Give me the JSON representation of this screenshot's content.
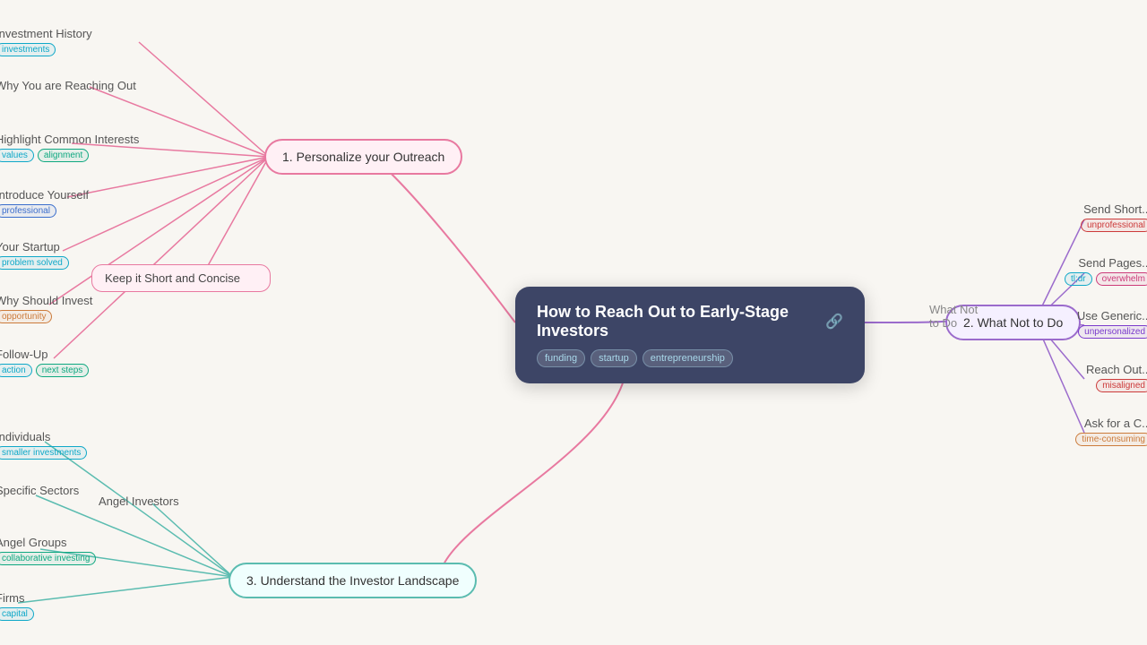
{
  "app": {
    "title": "How to Reach Out to Early-Stage Investors"
  },
  "central": {
    "title": "How to Reach Out to Early-Stage Investors",
    "link_icon": "🔗",
    "tags": [
      "funding",
      "startup",
      "entrepreneurship"
    ]
  },
  "branches": {
    "personalize": {
      "label": "1. Personalize your Outreach",
      "leaves": [
        {
          "label": "Investment History",
          "tags": [
            {
              "text": "investments",
              "type": "cyan"
            }
          ]
        },
        {
          "label": "Why You are Reaching Out",
          "tags": []
        },
        {
          "label": "Highlight Common Interests",
          "tags": [
            {
              "text": "values",
              "type": "cyan"
            },
            {
              "text": "alignment",
              "type": "teal"
            }
          ]
        },
        {
          "label": "Introduce Yourself",
          "tags": [
            {
              "text": "professional",
              "type": "blue"
            }
          ]
        },
        {
          "label": "Your Startup",
          "tags": [
            {
              "text": "problem solved",
              "type": "cyan"
            }
          ]
        },
        {
          "label": "Why Should Invest",
          "tags": [
            {
              "text": "opportunity",
              "type": "orange"
            }
          ]
        },
        {
          "label": "Follow-Up",
          "tags": [
            {
              "text": "action",
              "type": "cyan"
            },
            {
              "text": "next steps",
              "type": "teal"
            }
          ]
        }
      ]
    },
    "short": {
      "label": "Keep it Short and Concise",
      "tags": []
    },
    "whatnot": {
      "label": "2. What Not to Do",
      "leaves": [
        {
          "label": "Send Short...",
          "tags": [
            {
              "text": "unprofessional",
              "type": "red"
            }
          ]
        },
        {
          "label": "Send Pages...",
          "tags": [
            {
              "text": "tl;dr",
              "type": "cyan"
            },
            {
              "text": "overwhelm",
              "type": "pink"
            }
          ]
        },
        {
          "label": "Use Generic...",
          "tags": [
            {
              "text": "unpersonalized",
              "type": "purple"
            }
          ]
        },
        {
          "label": "Reach Out...",
          "tags": [
            {
              "text": "misaligned",
              "type": "red"
            }
          ]
        },
        {
          "label": "Ask for a C...",
          "tags": [
            {
              "text": "time-consuming",
              "type": "orange"
            }
          ]
        }
      ]
    },
    "understand": {
      "label": "3. Understand the Investor Landscape",
      "leaves": [
        {
          "label": "Individuals",
          "tags": [
            {
              "text": "smaller investments",
              "type": "cyan"
            }
          ]
        },
        {
          "label": "Specific Sectors",
          "tags": []
        },
        {
          "label": "Angel Investors",
          "tags": []
        },
        {
          "label": "Angel Groups",
          "tags": [
            {
              "text": "collaborative investing",
              "type": "teal"
            }
          ]
        },
        {
          "label": "Firms",
          "tags": [
            {
              "text": "capital",
              "type": "cyan"
            }
          ]
        }
      ]
    }
  }
}
